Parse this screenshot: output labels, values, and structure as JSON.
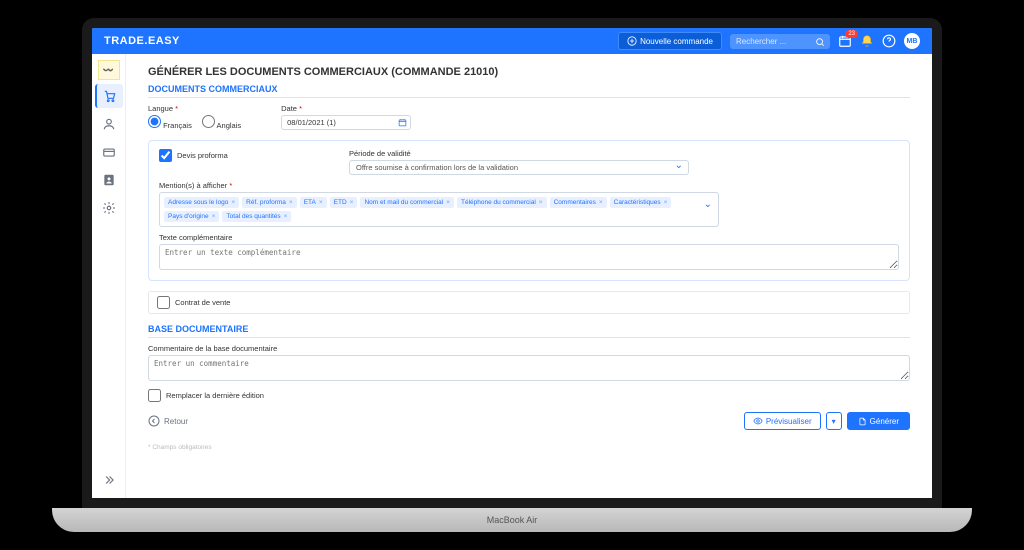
{
  "brand": "TRADE.EASY",
  "topbar": {
    "new_order": "Nouvelle commande",
    "search_placeholder": "Rechercher ...",
    "notif_badge": "23",
    "avatar_initials": "MB"
  },
  "page": {
    "title": "GÉNÉRER LES DOCUMENTS COMMERCIAUX (COMMANDE 21010)",
    "section_commercial": "DOCUMENTS COMMERCIAUX",
    "section_docbase": "BASE DOCUMENTAIRE",
    "lang_label": "Langue",
    "lang_fr": "Français",
    "lang_en": "Anglais",
    "date_label": "Date",
    "date_value": "08/01/2021 (1)",
    "devis_proforma": "Devis proforma",
    "periode_label": "Période de validité",
    "periode_value": "Offre soumise à confirmation lors de la validation",
    "mentions_label": "Mention(s) à afficher",
    "complement_label": "Texte complémentaire",
    "complement_placeholder": "Entrer un texte complémentaire",
    "contrat_vente": "Contrat de vente",
    "docbase_comment_label": "Commentaire de la base documentaire",
    "docbase_comment_placeholder": "Entrer un commentaire",
    "replace_last": "Remplacer la dernière édition",
    "back": "Retour",
    "preview": "Prévisualiser",
    "generate": "Générer",
    "footnote": "* Champs obligatoires"
  },
  "tags": [
    "Adresse sous le logo",
    "Réf. proforma",
    "ETA",
    "ETD",
    "Nom et mail du commercial",
    "Téléphone du commercial",
    "Commentaires",
    "Caractéristiques",
    "Pays d'origine",
    "Total des quantités"
  ],
  "laptop_label": "MacBook Air"
}
